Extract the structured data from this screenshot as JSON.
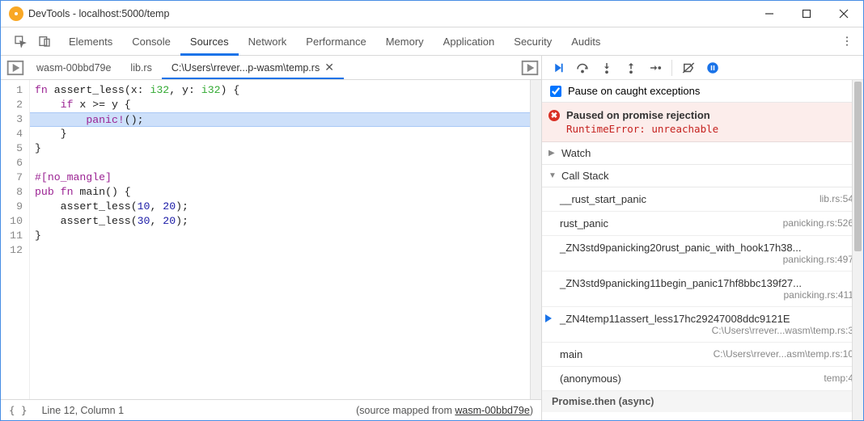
{
  "window": {
    "title": "DevTools - localhost:5000/temp"
  },
  "main_tabs": {
    "items": [
      "Elements",
      "Console",
      "Sources",
      "Network",
      "Performance",
      "Memory",
      "Application",
      "Security",
      "Audits"
    ],
    "active_index": 2
  },
  "source_tabs": {
    "items": [
      {
        "label": "wasm-00bbd79e"
      },
      {
        "label": "lib.rs"
      },
      {
        "label": "C:\\Users\\rrever...p-wasm\\temp.rs",
        "active": true,
        "closable": true
      }
    ]
  },
  "editor": {
    "highlighted_line": 3,
    "lines": [
      {
        "n": 1,
        "html": "<span class='kw'>fn</span> <span class='fn'>assert_less</span>(x: <span class='ty'>i32</span>, y: <span class='ty'>i32</span>) {"
      },
      {
        "n": 2,
        "html": "    <span class='kw'>if</span> x &gt;= y {"
      },
      {
        "n": 3,
        "html": "        <span class='mac'>panic!</span>();"
      },
      {
        "n": 4,
        "html": "    }"
      },
      {
        "n": 5,
        "html": "}"
      },
      {
        "n": 6,
        "html": ""
      },
      {
        "n": 7,
        "html": "<span class='attr'>#[no_mangle]</span>"
      },
      {
        "n": 8,
        "html": "<span class='kw'>pub fn</span> <span class='fn'>main</span>() {"
      },
      {
        "n": 9,
        "html": "    assert_less(<span class='num'>10</span>, <span class='num'>20</span>);"
      },
      {
        "n": 10,
        "html": "    assert_less(<span class='num'>30</span>, <span class='num'>20</span>);"
      },
      {
        "n": 11,
        "html": "}"
      },
      {
        "n": 12,
        "html": ""
      }
    ]
  },
  "status": {
    "cursor": "Line 12, Column 1",
    "map_prefix": "(source mapped from ",
    "map_name": "wasm-00bbd79e",
    "map_suffix": ")"
  },
  "pause_checkbox_label": "Pause on caught exceptions",
  "paused": {
    "title": "Paused on promise rejection",
    "message": "RuntimeError: unreachable"
  },
  "sections": {
    "watch": "Watch",
    "call_stack": "Call Stack"
  },
  "call_stack": [
    {
      "fn": "__rust_start_panic",
      "loc": "lib.rs:54"
    },
    {
      "fn": "rust_panic",
      "loc": "panicking.rs:526"
    },
    {
      "fn": "_ZN3std9panicking20rust_panic_with_hook17h38...",
      "loc": "panicking.rs:497",
      "two_line": true
    },
    {
      "fn": "_ZN3std9panicking11begin_panic17hf8bbc139f27...",
      "loc": "panicking.rs:411",
      "two_line": true
    },
    {
      "fn": "_ZN4temp11assert_less17hc29247008ddc9121E",
      "loc": "C:\\Users\\rrever...wasm\\temp.rs:3",
      "two_line": true,
      "active": true
    },
    {
      "fn": "main",
      "loc": "C:\\Users\\rrever...asm\\temp.rs:10"
    },
    {
      "fn": "(anonymous)",
      "loc": "temp:4"
    }
  ],
  "async_label": "Promise.then (async)"
}
